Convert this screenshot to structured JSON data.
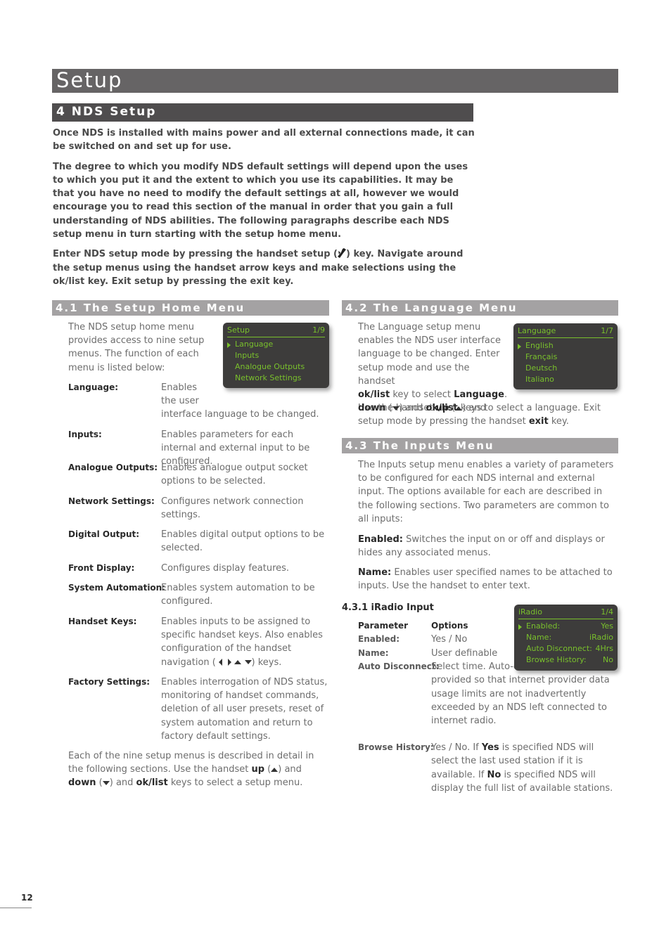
{
  "page": {
    "title": "Setup",
    "section_title": "4 NDS Setup",
    "page_number": "12"
  },
  "intro": {
    "p1": "Once NDS is installed with mains power and all external connections made, it can be switched on and set up for use.",
    "p2": "The degree to which you modify NDS default settings will depend upon the uses to which you put it and the extent to which you use its capabilities. It may be that you have no need to modify the default settings at all, however we would encourage you to read this section of the manual in order that you gain a full understanding of NDS abilities. The following paragraphs describe each NDS setup menu in turn starting with the setup home menu.",
    "p3_a": "Enter NDS setup mode by pressing the handset setup (",
    "p3_icon": "wrench-icon",
    "p3_b": ")  key. Navigate around the setup menus using the handset arrow keys and make selections using the ok/list key. Exit setup by pressing the exit key."
  },
  "s41": {
    "title": "4.1 The Setup Home Menu",
    "intro": "The NDS setup home menu provides access to nine setup menus. The function of each menu is listed below:",
    "definitions": [
      {
        "term": "Language:",
        "desc": "Enables the user interface language to be changed."
      },
      {
        "term": "Inputs:",
        "desc": "Enables parameters for each internal and external input to be configured."
      },
      {
        "term": "Analogue Outputs:",
        "desc": "Enables analogue output socket options to be selected."
      },
      {
        "term": "Network Settings:",
        "desc": "Configures network connection settings."
      },
      {
        "term": "Digital Output:",
        "desc": "Enables digital output options to be selected."
      },
      {
        "term": "Front Display:",
        "desc": "Configures display features."
      },
      {
        "term": "System Automation:",
        "desc": "Enables system automation to be configured."
      },
      {
        "term": "Handset Keys:",
        "desc_a": "Enables inputs to be assigned to specific handset keys. Also enables configuration of the handset navigation (",
        "desc_b": ") keys."
      },
      {
        "term": "Factory Settings:",
        "desc": "Enables interrogation of NDS status, monitoring of handset commands, deletion of all user presets, reset of system automation and return to factory default settings."
      }
    ],
    "outro": {
      "a": "Each of the nine setup menus is described in detail in the following sections. Use the handset ",
      "up": "up",
      "b": " (",
      "c": ") and ",
      "down": "down",
      "d": " (",
      "e": ") and ",
      "oklist": "ok/list",
      "f": " keys to select a setup menu."
    },
    "lcd": {
      "title": "Setup",
      "page": "1/9",
      "items": [
        "Language",
        "Inputs",
        "Analogue Outputs",
        "Network Settings"
      ],
      "selected_index": 0
    }
  },
  "s42": {
    "title": "4.2 The Language Menu",
    "text": {
      "a": "The Language setup menu enables the NDS user interface language to be changed. Enter setup mode and use the handset",
      "oklist1": "ok/list",
      "b": " key to select ",
      "language": "Language",
      "c": ".",
      "d": "Use the handset ",
      "up": "up",
      "e": " (",
      "f": ") and",
      "down": "down",
      "g": " (",
      "h": ") and ",
      "oklist2": "ok/list",
      "i": " keys to select a language. Exit setup mode by pressing the handset ",
      "exit": "exit",
      "j": " key."
    },
    "lcd": {
      "title": "Language",
      "page": "1/7",
      "items": [
        "English",
        "Français",
        "Deutsch",
        "Italiano"
      ],
      "selected_index": 0
    }
  },
  "s43": {
    "title": "4.3 The Inputs Menu",
    "intro": "The Inputs setup menu enables a variety of parameters to be configured for each NDS internal and external input. The options available for each are described in the following sections. Two parameters are common to all inputs:",
    "enabled_label": "Enabled:",
    "enabled_text": " Switches the input on or off and displays or hides any associated menus.",
    "name_label": "Name:",
    "name_text": " Enables user specified names to be attached to inputs. Use the handset to enter text."
  },
  "s431": {
    "title": "4.3.1 iRadio Input",
    "header_param": "Parameter",
    "header_options": "Options",
    "rows": [
      {
        "key": "Enabled:",
        "val": "Yes / No"
      },
      {
        "key": "Name:",
        "val": "User definable"
      },
      {
        "key": "Auto Disconnect:",
        "val": "Select time. Auto-disconnect is provided so that internet provider data usage limits are not inadvertently exceeded by an NDS left connected to internet radio."
      },
      {
        "key": "Browse History:",
        "val_a": "Yes / No. If ",
        "yes": "Yes",
        "val_b": " is specified NDS will select the last used station if it is available. If ",
        "no": "No",
        "val_c": " is specified NDS will display the full list of available stations."
      }
    ],
    "lcd": {
      "title": "iRadio",
      "page": "1/4",
      "items": [
        {
          "label": "Enabled:",
          "value": "Yes"
        },
        {
          "label": "Name:",
          "value": "iRadio"
        },
        {
          "label": "Auto Disconnect:",
          "value": "4Hrs"
        },
        {
          "label": "Browse History:",
          "value": "No"
        }
      ],
      "selected_index": 0
    }
  },
  "colors": {
    "title_bar": "#666465",
    "section_bar": "#4f4d4e",
    "sub_bar": "#a4a2a3",
    "lcd_bg": "#3d3c3b",
    "lcd_text": "#79c02c"
  }
}
